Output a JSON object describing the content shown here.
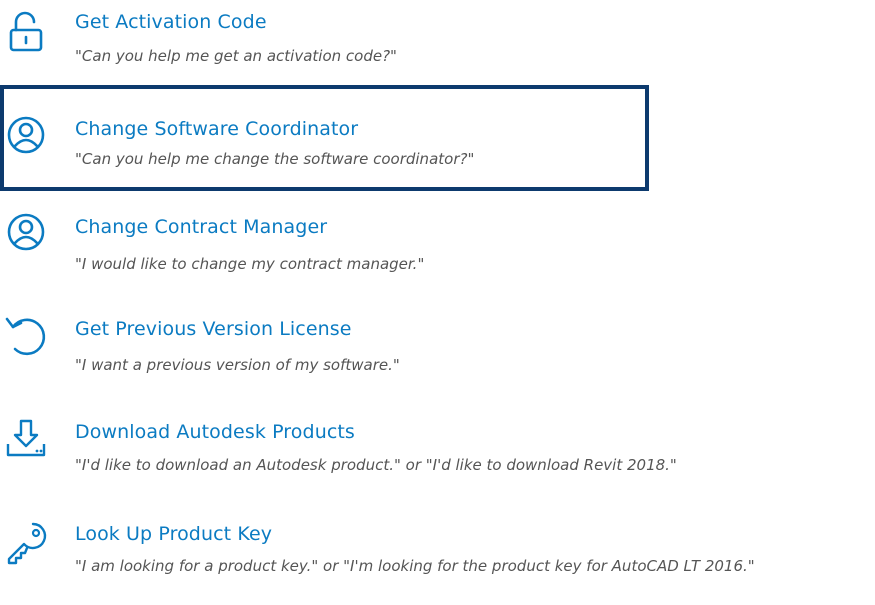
{
  "items": [
    {
      "title": "Get Activation Code",
      "description": "\"Can you help me get an activation code?\"",
      "icon": "lock-icon",
      "selected": false
    },
    {
      "title": "Change Software Coordinator",
      "description": "\"Can you help me change the software coordinator?\"",
      "icon": "user-circle-icon",
      "selected": true
    },
    {
      "title": "Change Contract Manager",
      "description": "\"I would like to change my contract manager.\"",
      "icon": "user-circle-icon",
      "selected": false
    },
    {
      "title": "Get Previous Version License",
      "description": "\"I want a previous version of my software.\"",
      "icon": "undo-arrow-icon",
      "selected": false
    },
    {
      "title": "Download Autodesk Products",
      "description": "\"I'd like to download an Autodesk product.\" or \"I'd like to download Revit 2018.\"",
      "icon": "download-icon",
      "selected": false
    },
    {
      "title": "Look Up Product Key",
      "description": "\"I am looking for a product key.\" or \"I'm looking for the product key for AutoCAD LT 2016.\"",
      "icon": "key-icon",
      "selected": false
    }
  ],
  "colors": {
    "title": "#0b7bc2",
    "description": "#555555",
    "icon": "#0b7bc2",
    "selection_border": "#0d3a6e"
  }
}
